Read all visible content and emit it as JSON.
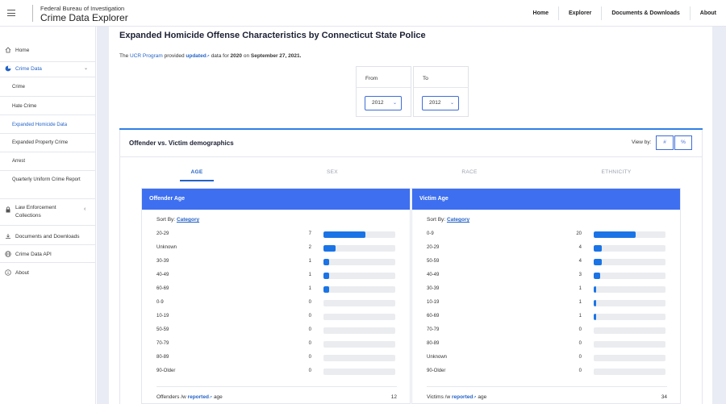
{
  "header": {
    "logo_line1": "Federal Bureau of Investigation",
    "logo_line2": "Crime Data Explorer",
    "nav": [
      "Home",
      "Explorer",
      "Documents & Downloads",
      "About"
    ]
  },
  "sidebar": {
    "home": "Home",
    "crime_data": "Crime Data",
    "sub_items": [
      "Crime",
      "Hate Crime",
      "Expanded Homicide Data",
      "Expanded Property Crime",
      "Arrest",
      "Quarterly Uniform Crime Report"
    ],
    "active_sub": "Expanded Homicide Data",
    "law_enforcement": "Law Enforcement Collections",
    "documents": "Documents and Downloads",
    "api": "Crime Data API",
    "about": "About"
  },
  "page": {
    "title": "Expanded Homicide Offense Characteristics by Connecticut State Police",
    "ucr_prefix": "The",
    "ucr_link": "UCR Program",
    "ucr_mid": "provided",
    "ucr_updated": "updated",
    "ucr_mid2": "data for",
    "ucr_year": "2020",
    "ucr_on": "on",
    "ucr_date": "September 27, 2021."
  },
  "filters": {
    "from_label": "From",
    "from_value": "2012",
    "to_label": "To",
    "to_value": "2012"
  },
  "section": {
    "title": "Offender vs. Victim demographics",
    "view_by": "View by:",
    "btn_count": "#",
    "btn_percent": "%",
    "tabs": [
      "AGE",
      "SEX",
      "RACE",
      "ETHNICITY"
    ],
    "active_tab": "AGE"
  },
  "offender": {
    "title": "Offender Age",
    "sort_prefix": "Sort By:",
    "sort_link": "Category",
    "max": 12,
    "rows": [
      {
        "label": "20-29",
        "value": 7
      },
      {
        "label": "Unknown",
        "value": 2
      },
      {
        "label": "30-39",
        "value": 1
      },
      {
        "label": "40-49",
        "value": 1
      },
      {
        "label": "60-69",
        "value": 1
      },
      {
        "label": "0-9",
        "value": 0
      },
      {
        "label": "10-19",
        "value": 0
      },
      {
        "label": "50-59",
        "value": 0
      },
      {
        "label": "70-79",
        "value": 0
      },
      {
        "label": "80-89",
        "value": 0
      },
      {
        "label": "90-Older",
        "value": 0
      }
    ],
    "foot_prefix": "Offenders /w",
    "foot_link": "reported",
    "foot_suffix": "age",
    "total": "12"
  },
  "victim": {
    "title": "Victim Age",
    "sort_prefix": "Sort By:",
    "sort_link": "Category",
    "max": 34,
    "rows": [
      {
        "label": "0-9",
        "value": 20
      },
      {
        "label": "20-29",
        "value": 4
      },
      {
        "label": "50-59",
        "value": 4
      },
      {
        "label": "40-49",
        "value": 3
      },
      {
        "label": "30-39",
        "value": 1
      },
      {
        "label": "10-19",
        "value": 1
      },
      {
        "label": "60-69",
        "value": 1
      },
      {
        "label": "70-79",
        "value": 0
      },
      {
        "label": "80-89",
        "value": 0
      },
      {
        "label": "Unknown",
        "value": 0
      },
      {
        "label": "90-Older",
        "value": 0
      }
    ],
    "foot_prefix": "Victims /w",
    "foot_link": "reported",
    "foot_suffix": "age",
    "total": "34"
  },
  "colors": {
    "accent": "#3d6ff0",
    "bar": "#1a74e6",
    "link": "#2463c7"
  }
}
